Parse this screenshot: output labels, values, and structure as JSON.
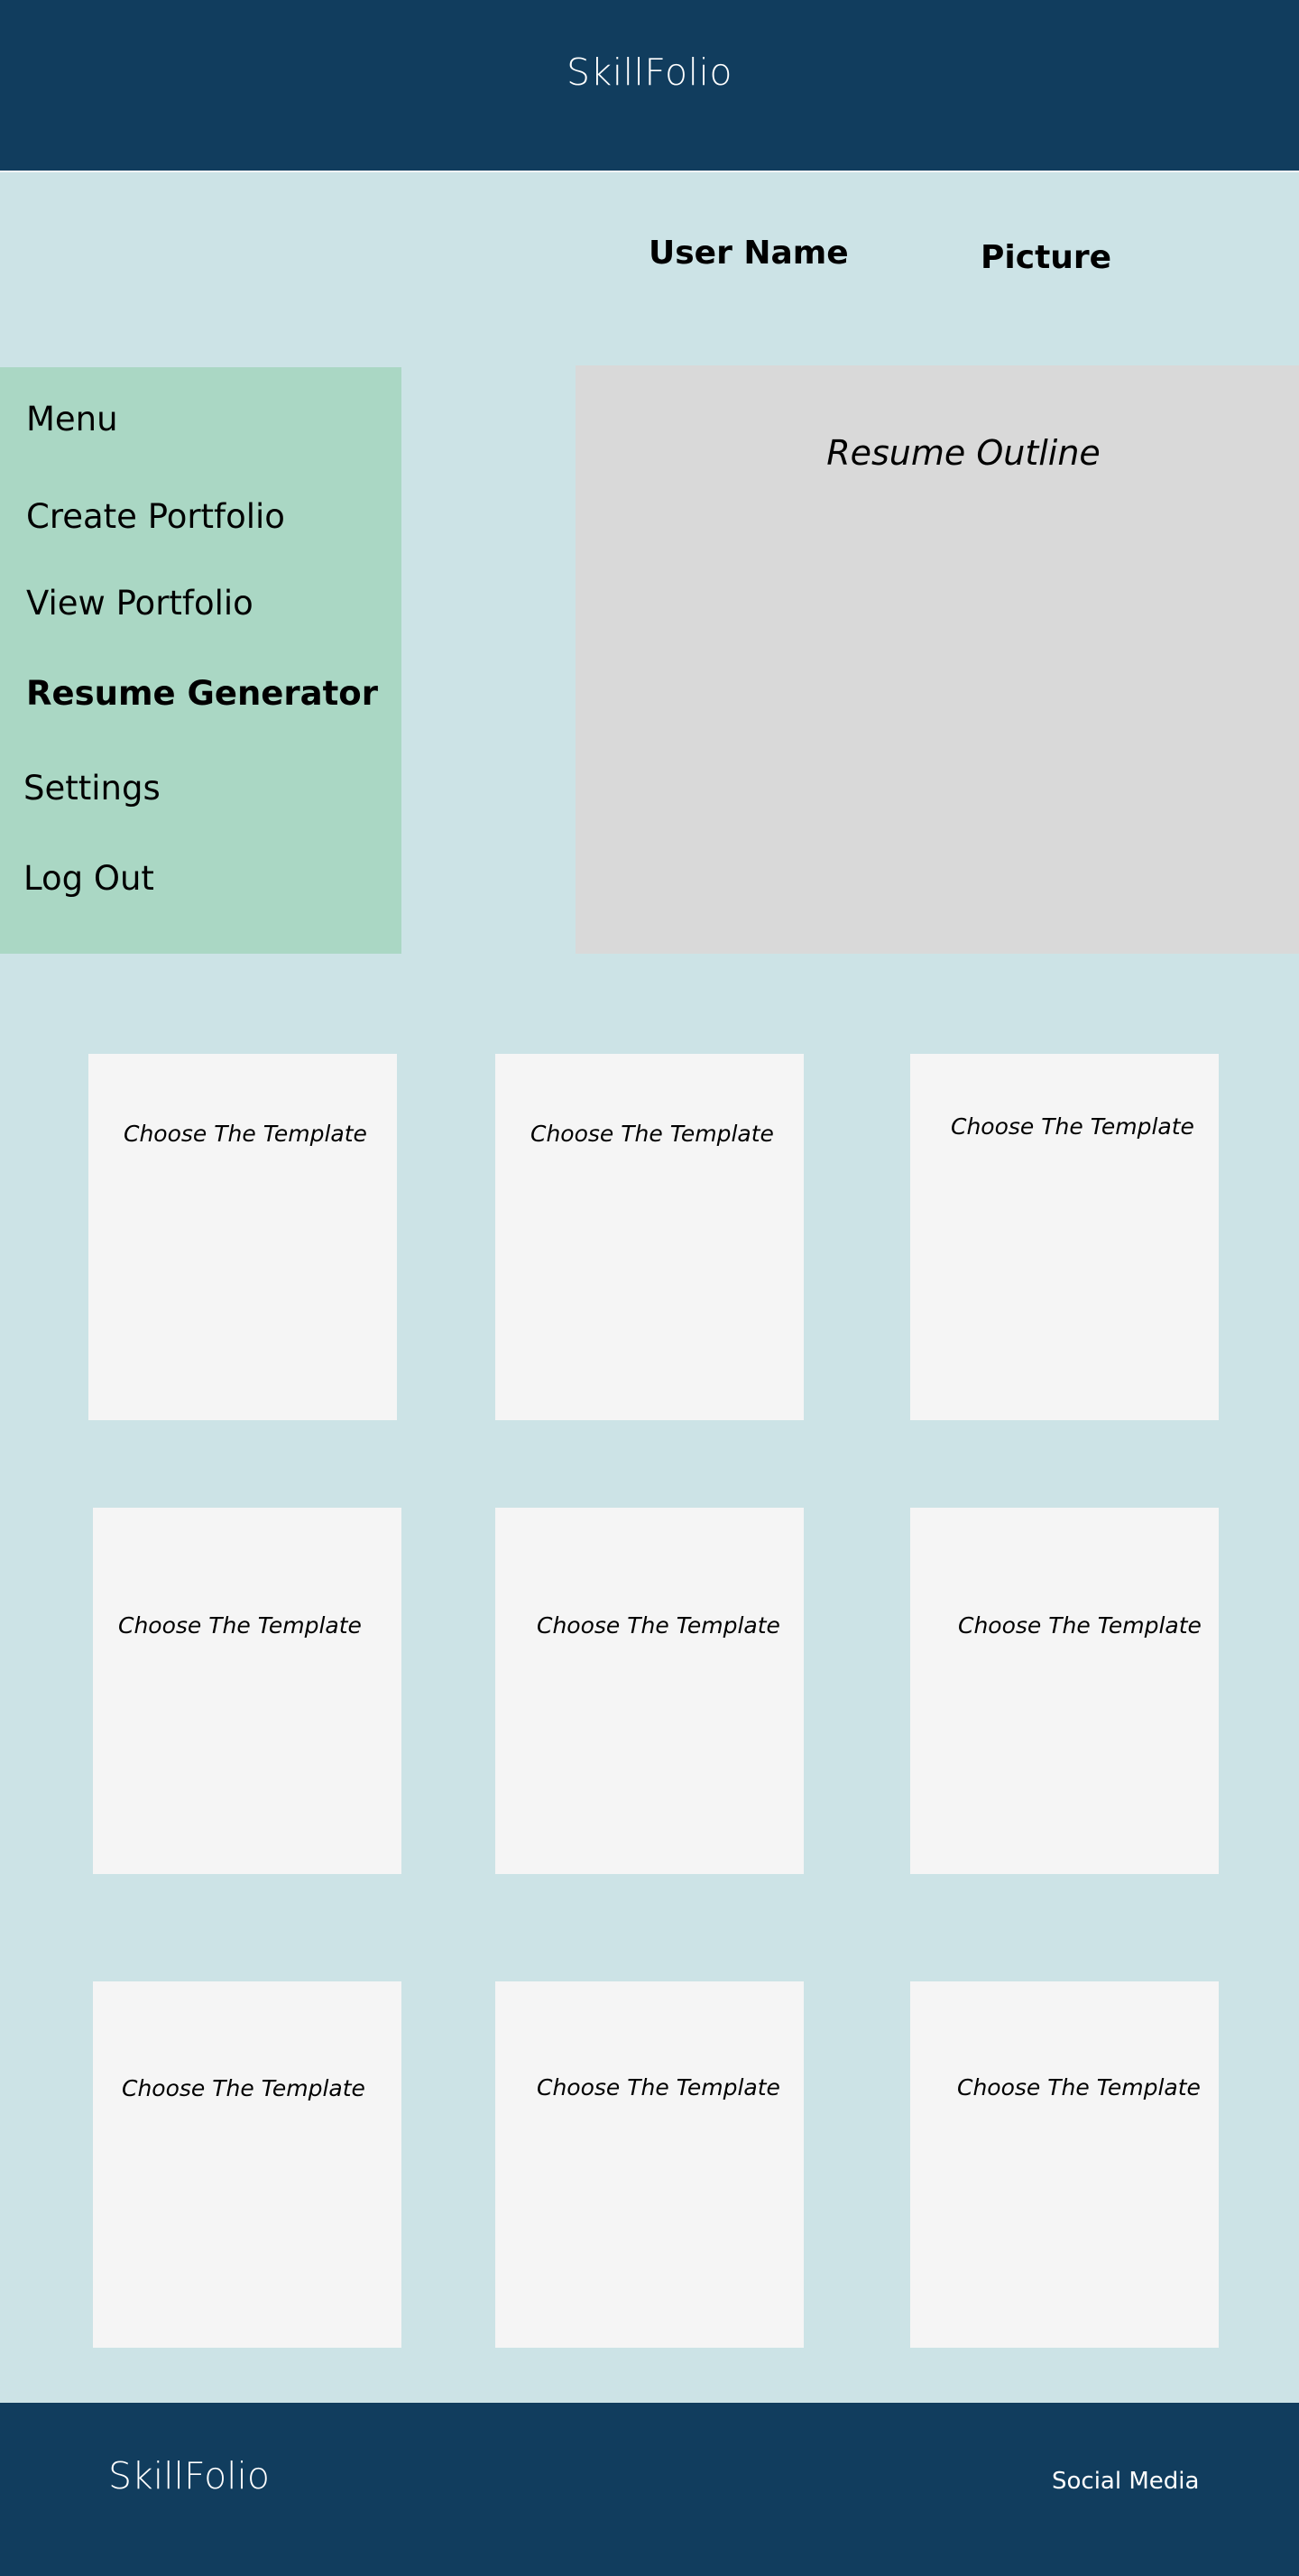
{
  "header": {
    "brand": "SkillFolio"
  },
  "profile": {
    "user_name": "User Name",
    "picture": "Picture"
  },
  "menu": {
    "title": "Menu",
    "items": [
      {
        "label": "Create Portfolio"
      },
      {
        "label": "View Portfolio"
      },
      {
        "label": "Resume Generator"
      },
      {
        "label": "Settings"
      },
      {
        "label": "Log Out"
      }
    ]
  },
  "resume_outline": {
    "title": "Resume Outline"
  },
  "templates": [
    {
      "label": "Choose The Template"
    },
    {
      "label": "Choose The Template"
    },
    {
      "label": "Choose The Template"
    },
    {
      "label": "Choose The Template"
    },
    {
      "label": "Choose The Template"
    },
    {
      "label": "Choose The Template"
    },
    {
      "label": "Choose The Template"
    },
    {
      "label": "Choose The Template"
    },
    {
      "label": "Choose The Template"
    }
  ],
  "footer": {
    "brand": "SkillFolio",
    "social": "Social Media"
  },
  "colors": {
    "header_bg": "#113d5e",
    "page_bg": "#cce3e6",
    "menu_bg": "#aad7c4",
    "outline_bg": "#d9d9d9",
    "card_bg": "#f5f5f5"
  }
}
